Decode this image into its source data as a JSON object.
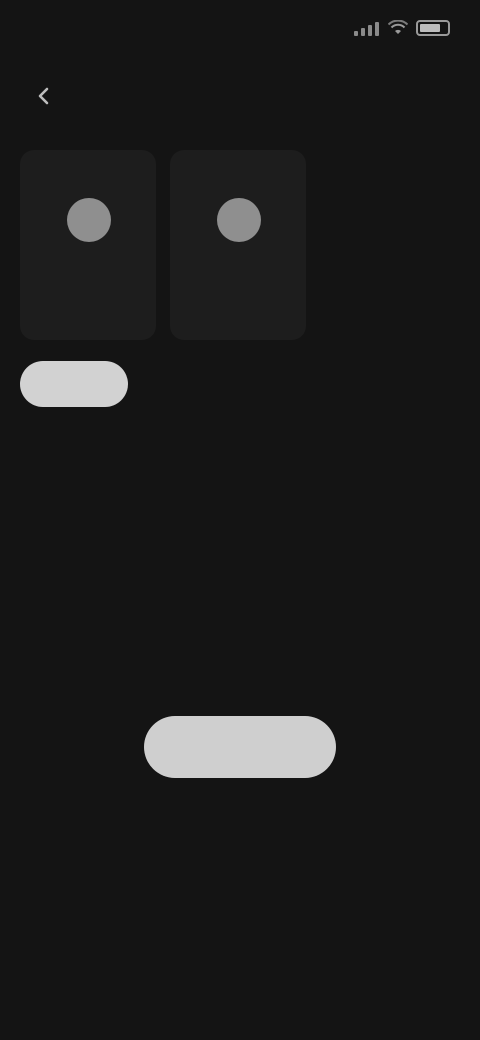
{
  "status_bar": {
    "time": "",
    "icons": [
      "signal-icon",
      "wifi-icon",
      "battery-icon"
    ]
  },
  "header": {
    "title": "",
    "back_icon": "chevron-left-icon"
  },
  "participants": [
    {
      "name": ""
    },
    {
      "name": ""
    }
  ],
  "tabs": [
    {
      "label": "",
      "active": true
    },
    {
      "label": "",
      "active": false
    },
    {
      "label": "",
      "active": false
    }
  ],
  "empty_state": {
    "title": "",
    "subtitle": "",
    "button_label": ""
  },
  "colors": {
    "background": "#141414",
    "card": "#1d1d1d",
    "accent_light": "#d2d2d2"
  }
}
